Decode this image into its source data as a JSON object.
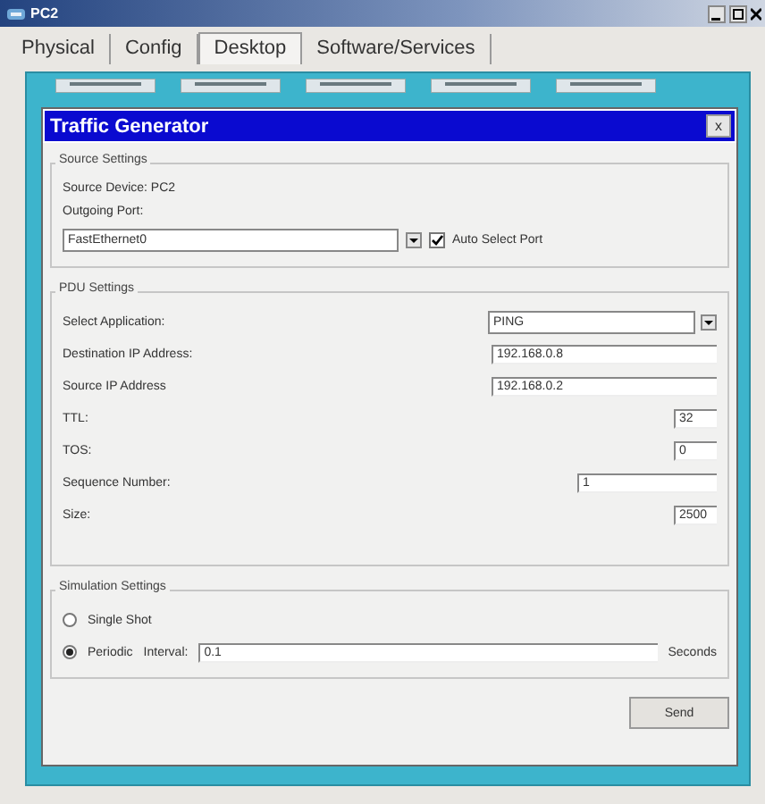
{
  "window": {
    "title": "PC2"
  },
  "tabs": [
    {
      "label": "Physical",
      "selected": false
    },
    {
      "label": "Config",
      "selected": false
    },
    {
      "label": "Desktop",
      "selected": true
    },
    {
      "label": "Software/Services",
      "selected": false
    }
  ],
  "dialog": {
    "title": "Traffic Generator",
    "close": "x",
    "source_settings": {
      "legend": "Source Settings",
      "source_device": "Source Device: PC2",
      "outgoing_port_label": "Outgoing Port:",
      "outgoing_port": "FastEthernet0",
      "auto_select": {
        "label": "Auto Select Port",
        "checked": true
      }
    },
    "pdu_settings": {
      "legend": "PDU Settings",
      "fields": [
        {
          "kind": "dropdown",
          "label": "Select Application:",
          "value": "PING"
        },
        {
          "kind": "wide",
          "label": "Destination IP Address:",
          "value": "192.168.0.8"
        },
        {
          "kind": "wide",
          "label": "Source IP Address",
          "value": "192.168.0.2"
        },
        {
          "kind": "short",
          "label": "TTL:",
          "value": "32"
        },
        {
          "kind": "short",
          "label": "TOS:",
          "value": "0"
        },
        {
          "kind": "medium",
          "label": "Sequence Number:",
          "value": "1"
        },
        {
          "kind": "short",
          "label": "Size:",
          "value": "2500"
        }
      ]
    },
    "simulation_settings": {
      "legend": "Simulation Settings",
      "modes": [
        {
          "label": "Single Shot",
          "selected": false
        },
        {
          "label": "Periodic",
          "selected": true
        }
      ],
      "interval_label": "Interval:",
      "interval": "0.1",
      "unit": "Seconds"
    },
    "send": "Send"
  }
}
